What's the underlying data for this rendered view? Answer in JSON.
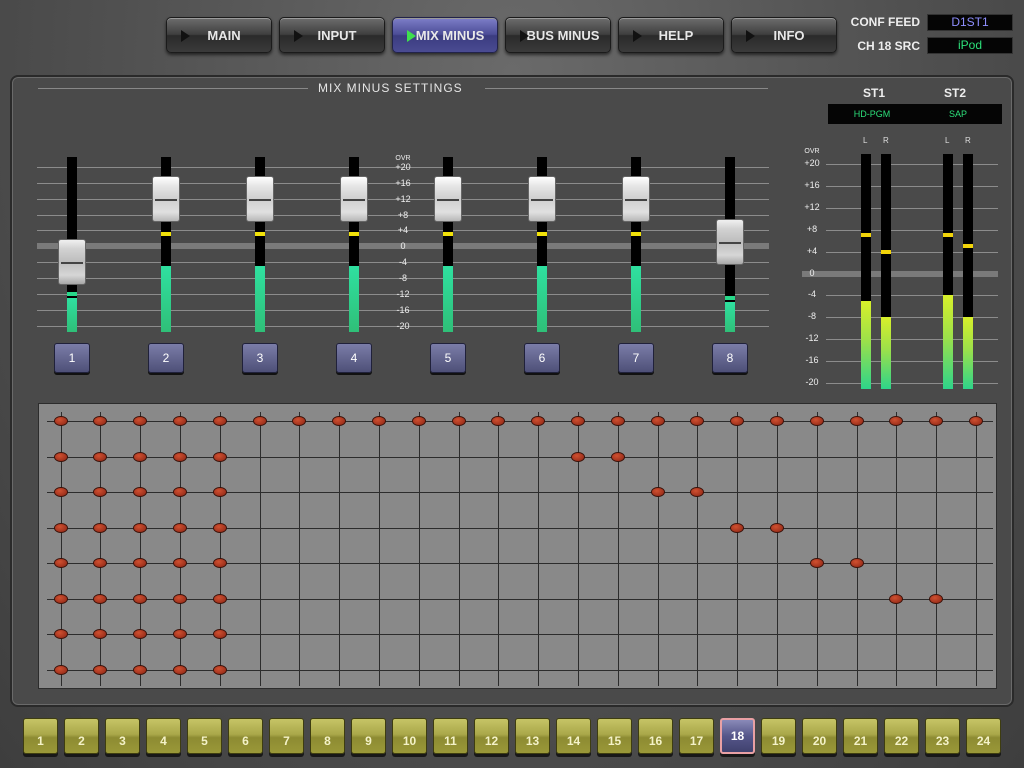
{
  "nav": [
    {
      "label": "MAIN",
      "active": false
    },
    {
      "label": "INPUT",
      "active": false
    },
    {
      "label": "MIX MINUS",
      "active": true
    },
    {
      "label": "BUS MINUS",
      "active": false
    },
    {
      "label": "HELP",
      "active": false
    },
    {
      "label": "INFO",
      "active": false
    }
  ],
  "conf": {
    "feed_label": "CONF FEED",
    "feed_value": "D1ST1",
    "feed_color": "#8f8fff",
    "src_label": "CH 18 SRC",
    "src_value": "iPod",
    "src_color": "#2de07a"
  },
  "panel": {
    "title": "MIX MINUS SETTINGS"
  },
  "fader_scale": [
    "OVR",
    "+20",
    "+16",
    "+12",
    "+8",
    "+4",
    "0",
    "-4",
    "-8",
    "-12",
    "-16",
    "-20"
  ],
  "channels": [
    {
      "label": "1",
      "fader_db": -4,
      "meter_db": -13,
      "gain_db": null
    },
    {
      "label": "2",
      "fader_db": 12,
      "meter_db": -5,
      "gain_db": 3
    },
    {
      "label": "3",
      "fader_db": 12,
      "meter_db": -5,
      "gain_db": 3
    },
    {
      "label": "4",
      "fader_db": 12,
      "meter_db": -5,
      "gain_db": 3
    },
    {
      "label": "5",
      "fader_db": 12,
      "meter_db": -5,
      "gain_db": 3
    },
    {
      "label": "6",
      "fader_db": 12,
      "meter_db": -5,
      "gain_db": 3
    },
    {
      "label": "7",
      "fader_db": 12,
      "meter_db": -5,
      "gain_db": 3
    },
    {
      "label": "8",
      "fader_db": 1,
      "meter_db": -14,
      "gain_db": null
    }
  ],
  "stereo": {
    "scale": [
      "OVR",
      "+20",
      "+16",
      "+12",
      "+8",
      "+4",
      "0",
      "-4",
      "-8",
      "-12",
      "-16",
      "-20"
    ],
    "buses": [
      {
        "name": "ST1",
        "assignment": "HD-PGM",
        "lr": [
          "L",
          "R"
        ],
        "levels_db": [
          -5,
          -8
        ],
        "peaks_db": [
          7,
          4
        ]
      },
      {
        "name": "ST2",
        "assignment": "SAP",
        "lr": [
          "L",
          "R"
        ],
        "levels_db": [
          -4,
          -8
        ],
        "peaks_db": [
          7,
          5
        ]
      }
    ]
  },
  "matrix": {
    "rows": 8,
    "cols": 24,
    "assignments": [
      [
        1,
        2,
        3,
        4,
        5,
        6,
        7,
        8,
        9,
        10,
        11,
        12,
        13,
        14,
        15,
        16,
        17,
        18,
        19,
        20,
        21,
        22,
        23,
        24
      ],
      [
        1,
        2,
        3,
        4,
        5,
        14,
        15
      ],
      [
        1,
        2,
        3,
        4,
        5,
        16,
        17
      ],
      [
        1,
        2,
        3,
        4,
        5,
        18,
        19
      ],
      [
        1,
        2,
        3,
        4,
        5,
        20,
        21
      ],
      [
        1,
        2,
        3,
        4,
        5,
        22,
        23
      ],
      [
        1,
        2,
        3,
        4,
        5
      ],
      [
        1,
        2,
        3,
        4,
        5
      ]
    ]
  },
  "bottom_channels": {
    "labels": [
      "1",
      "2",
      "3",
      "4",
      "5",
      "6",
      "7",
      "8",
      "9",
      "10",
      "11",
      "12",
      "13",
      "14",
      "15",
      "16",
      "17",
      "18",
      "19",
      "20",
      "21",
      "22",
      "23",
      "24"
    ],
    "active": "18"
  }
}
